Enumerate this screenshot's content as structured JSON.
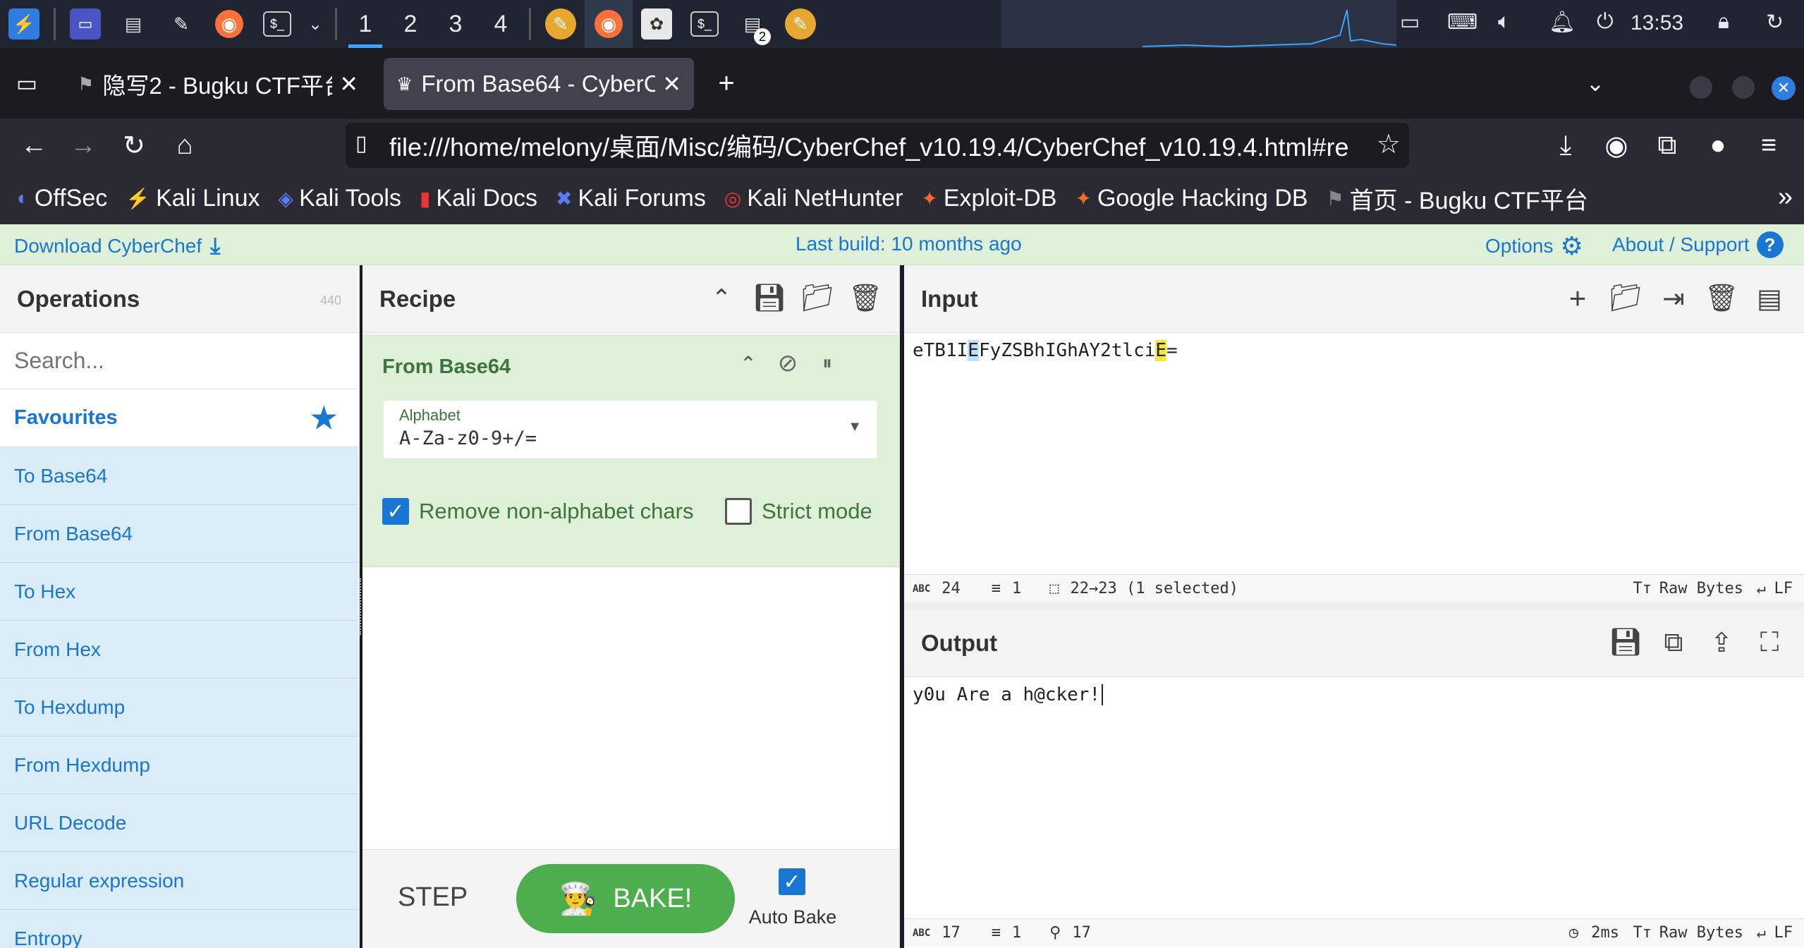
{
  "taskbar": {
    "workspaces": [
      "1",
      "2",
      "3",
      "4"
    ],
    "active_workspace": "1",
    "clock": "13:53",
    "badge_count": "2"
  },
  "tabs": [
    {
      "title": "隐写2 - Bugku CTF平台",
      "active": false
    },
    {
      "title": "From Base64 - CyberChef",
      "active": true
    }
  ],
  "url": "file:///home/melony/桌面/Misc/编码/CyberChef_v10.19.4/CyberChef_v10.19.4.html#re",
  "bookmarks": [
    {
      "label": "OffSec",
      "icon": "offsec-icon"
    },
    {
      "label": "Kali Linux",
      "icon": "kali-icon"
    },
    {
      "label": "Kali Tools",
      "icon": "kali-tools-icon"
    },
    {
      "label": "Kali Docs",
      "icon": "kali-docs-icon"
    },
    {
      "label": "Kali Forums",
      "icon": "kali-forums-icon"
    },
    {
      "label": "Kali NetHunter",
      "icon": "nethunter-icon"
    },
    {
      "label": "Exploit-DB",
      "icon": "exploitdb-icon"
    },
    {
      "label": "Google Hacking DB",
      "icon": "ghdb-icon"
    },
    {
      "label": "首页 - Bugku CTF平台",
      "icon": "flag-icon"
    }
  ],
  "cyberchef": {
    "download": "Download CyberChef",
    "last_build": "Last build: 10 months ago",
    "options": "Options",
    "about": "About / Support",
    "operations": {
      "title": "Operations",
      "count": "440",
      "search_placeholder": "Search...",
      "favourites": "Favourites",
      "items": [
        "To Base64",
        "From Base64",
        "To Hex",
        "From Hex",
        "To Hexdump",
        "From Hexdump",
        "URL Decode",
        "Regular expression",
        "Entropy"
      ]
    },
    "recipe": {
      "title": "Recipe",
      "operation": "From Base64",
      "alphabet_label": "Alphabet",
      "alphabet_value": "A-Za-z0-9+/=",
      "remove_nonalpha": "Remove non-alphabet chars",
      "remove_nonalpha_checked": true,
      "strict_mode": "Strict mode",
      "strict_mode_checked": false,
      "step": "STEP",
      "bake": "BAKE!",
      "auto_bake": "Auto Bake",
      "auto_bake_checked": true
    },
    "input": {
      "title": "Input",
      "text_before": "eTB1I",
      "hl1": "E",
      "text_mid": "FyZSBhIGhAY2tlci",
      "hl2": "E",
      "text_after": "=",
      "length": "24",
      "lines": "1",
      "selection": "22→23 (1 selected)",
      "encoding": "Raw Bytes",
      "eol": "LF"
    },
    "output": {
      "title": "Output",
      "text": "y0u Are a h@cker!",
      "length": "17",
      "lines": "1",
      "position": "17",
      "time": "2ms",
      "encoding": "Raw Bytes",
      "eol": "LF"
    }
  },
  "colors": {
    "accent_blue": "#1976d2",
    "recipe_green": "#dff0d8",
    "bake_green": "#4cae4c",
    "ops_blue": "#d9ecf7"
  }
}
